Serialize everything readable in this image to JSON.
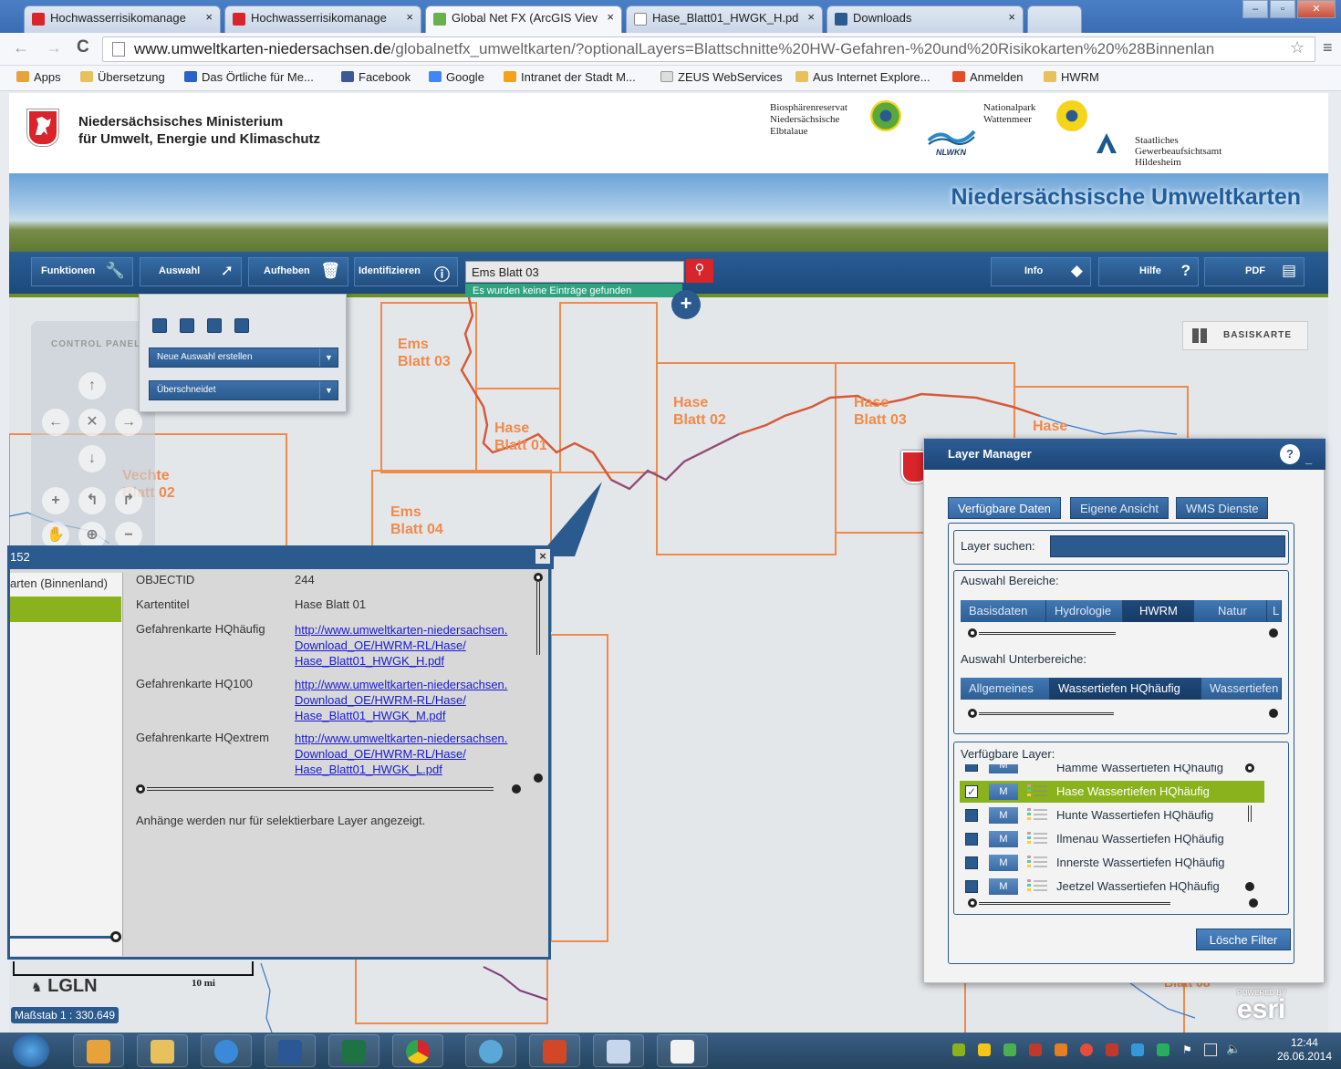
{
  "browser": {
    "tabs": [
      {
        "label": "Hochwasserrisikomanage",
        "color": "#d9242b"
      },
      {
        "label": "Hochwasserrisikomanage",
        "color": "#d9242b"
      },
      {
        "label": "Global Net FX (ArcGIS Viev",
        "color": "#6ab04c"
      },
      {
        "label": "Hase_Blatt01_HWGK_H.pd",
        "color": "#ffffff"
      },
      {
        "label": "Downloads",
        "color": "#2a5a8e"
      }
    ],
    "url_host": "www.umweltkarten-niedersachsen.de",
    "url_path": "/globalnetfx_umweltkarten/?optionalLayers=Blattschnitte%20HW-Gefahren-%20und%20Risikokarten%20%28Binnenlan",
    "bookmarks": [
      {
        "label": "Apps",
        "color": "#e8a23a"
      },
      {
        "label": "Übersetzung",
        "color": "#e8c15c"
      },
      {
        "label": "Das Örtliche für Me...",
        "color": "#2a62c9"
      },
      {
        "label": "Facebook",
        "color": "#3b5998"
      },
      {
        "label": "Google",
        "color": "#4285f4"
      },
      {
        "label": "Intranet der Stadt M...",
        "color": "#f4a21b"
      },
      {
        "label": "ZEUS WebServices",
        "color": "#dddddd"
      },
      {
        "label": "Aus Internet Explore...",
        "color": "#e8c15c"
      },
      {
        "label": "Anmelden",
        "color": "#e34d2a"
      },
      {
        "label": "HWRM",
        "color": "#e8c15c"
      }
    ]
  },
  "header": {
    "ministry_line1": "Niedersächsisches Ministerium",
    "ministry_line2": "für Umwelt, Energie und Klimaschutz",
    "bio_line1": "Biosphärenreservat",
    "bio_line2": "Niedersächsische",
    "bio_line3": "Elbtalaue",
    "nlwkn": "NLWKN",
    "np_line1": "Nationalpark",
    "np_line2": "Wattenmeer",
    "gaa_line1": "Staatliches",
    "gaa_line2": "Gewerbeaufsichtsamt",
    "gaa_line3": "Hildesheim",
    "banner_title": "Niedersächsische Umweltkarten"
  },
  "toolbar": {
    "funktionen": "Funktionen",
    "auswahl": "Auswahl",
    "aufheben": "Aufheben",
    "identifizieren": "Identifizieren",
    "search_value": "Ems Blatt 03",
    "search_message": "Es wurden keine Einträge gefunden",
    "info": "Info",
    "hilfe": "Hilfe",
    "pdf": "PDF"
  },
  "auswahl_panel": {
    "new_selection": "Neue Auswahl erstellen",
    "mode": "Überschneidet"
  },
  "map": {
    "control_panel_label": "CONTROL PANEL",
    "basiskarte": "BASISKARTE",
    "sheets": [
      {
        "line1": "Ems",
        "line2": "Blatt 03"
      },
      {
        "line1": "Hase",
        "line2": "Blatt 01"
      },
      {
        "line1": "Hase",
        "line2": "Blatt 02"
      },
      {
        "line1": "Hase",
        "line2": "Blatt 03"
      },
      {
        "line1": "Hase",
        "line2": ""
      },
      {
        "line1": "Vechte",
        "line2": "Blatt 02"
      },
      {
        "line1": "Ems",
        "line2": "Blatt 04"
      },
      {
        "line1": "",
        "line2": "Blatt 08"
      }
    ],
    "scale_label": "10 mi",
    "scale_text": "Maßstab 1 : 330.649",
    "lgln": "LGLN",
    "esri_small": "POWERED BY",
    "esri": "esri"
  },
  "popup": {
    "header_text": "152",
    "left_item": "arten (Binnenland)",
    "rows": [
      {
        "label": "OBJECTID",
        "value": "244"
      },
      {
        "label": "Kartentitel",
        "value": "Hase Blatt 01"
      }
    ],
    "links": [
      {
        "label": "Gefahrenkarte HQhäufig",
        "l1": "http://www.umweltkarten-niedersachsen.",
        "l2": "Download_OE/HWRM-RL/Hase/",
        "l3": "Hase_Blatt01_HWGK_H.pdf"
      },
      {
        "label": "Gefahrenkarte HQ100",
        "l1": "http://www.umweltkarten-niedersachsen.",
        "l2": "Download_OE/HWRM-RL/Hase/",
        "l3": "Hase_Blatt01_HWGK_M.pdf"
      },
      {
        "label": "Gefahrenkarte HQextrem",
        "l1": "http://www.umweltkarten-niedersachsen.",
        "l2": "Download_OE/HWRM-RL/Hase/",
        "l3": "Hase_Blatt01_HWGK_L.pdf"
      }
    ],
    "footer": "Anhänge werden nur für selektierbare Layer angezeigt."
  },
  "layer_manager": {
    "title": "Layer Manager",
    "tabs": [
      "Verfügbare Daten",
      "Eigene Ansicht",
      "WMS Dienste"
    ],
    "search_label": "Layer suchen:",
    "bereiche_label": "Auswahl Bereiche:",
    "bereiche": [
      "Basisdaten",
      "Hydrologie",
      "HWRM",
      "Natur",
      "L"
    ],
    "unterbereiche_label": "Auswahl Unterbereiche:",
    "unterbereiche": [
      "Allgemeines",
      "Wassertiefen HQhäufig",
      "Wassertiefen"
    ],
    "layers_label": "Verfügbare Layer:",
    "m": "M",
    "layers": [
      "Hamme Wassertiefen HQhäufig",
      "Hase Wassertiefen HQhäufig",
      "Hunte Wassertiefen HQhäufig",
      "Ilmenau Wassertiefen HQhäufig",
      "Innerste Wassertiefen HQhäufig",
      "Jeetzel Wassertiefen HQhäufig"
    ],
    "clear_filter": "Lösche Filter"
  },
  "taskbar": {
    "time": "12:44",
    "date": "26.06.2014"
  }
}
